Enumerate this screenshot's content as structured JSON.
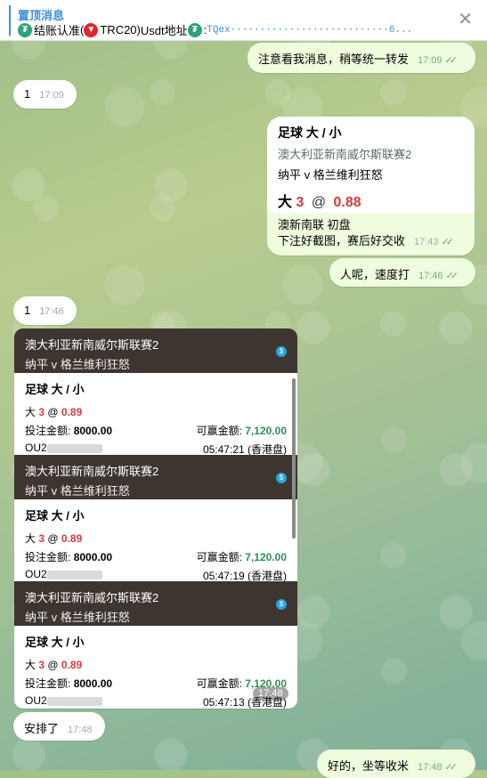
{
  "pinned": {
    "title": "置顶消息",
    "text_prefix": "结账认准",
    "tron_label": "TRC20",
    "text_middle": "Usdt地址",
    "address_label": ": ",
    "address": "TQex···························6..."
  },
  "messages": {
    "m1": {
      "text": "注意看我消息，稍等统一转发",
      "time": "17:09"
    },
    "m2": {
      "text": "1",
      "time": "17:09"
    },
    "card": {
      "line1": "足球 大 / 小",
      "line2": "澳大利亚新南威尔斯联赛2",
      "line3": "纳平 v 格兰维利狂怒",
      "pick": "大",
      "line_val": "3",
      "at": "@",
      "odds": "0.88",
      "note1": "澳新南联 初盘",
      "note2": "下注好截图，赛后好交收",
      "time": "17:43"
    },
    "m4": {
      "text": "人呢，速度打",
      "time": "17:46"
    },
    "m5": {
      "text": "1",
      "time": "17:46"
    },
    "m6": {
      "text": "安排了",
      "time": "17:48"
    },
    "m7": {
      "text": "好的，坐等收米",
      "time": "17:48"
    }
  },
  "bets": [
    {
      "league": "澳大利亚新南威尔斯联赛2",
      "teams": "纳平   v   格兰维利狂怒",
      "market": "足球 大 / 小",
      "pick": "大",
      "line": "3",
      "odds": "0.89",
      "stake_label": "投注金额:",
      "stake": "8000.00",
      "win_label": "可赢金额:",
      "win": "7,120.00",
      "id_prefix": "OU2",
      "time": "05:47:21 (香港盘)"
    },
    {
      "league": "澳大利亚新南威尔斯联赛2",
      "teams": "纳平   v   格兰维利狂怒",
      "market": "足球 大 / 小",
      "pick": "大",
      "line": "3",
      "odds": "0.89",
      "stake_label": "投注金额:",
      "stake": "8000.00",
      "win_label": "可赢金额:",
      "win": "7,120.00",
      "id_prefix": "OU2",
      "time": "05:47:19 (香港盘)"
    },
    {
      "league": "澳大利亚新南威尔斯联赛2",
      "teams": "纳平   v   格兰维利狂怒",
      "market": "足球 大 / 小",
      "pick": "大",
      "line": "3",
      "odds": "0.89",
      "stake_label": "投注金额:",
      "stake": "8000.00",
      "win_label": "可赢金额:",
      "win": "7,120.00",
      "id_prefix": "OU2",
      "time": "05:47:13 (香港盘)"
    }
  ],
  "image_time": "17:48",
  "colors": {
    "accent": "#3a8fd8",
    "outgoing_bubble": "#effdde",
    "bet_header": "#3d3530",
    "odds_red": "#d63a3a",
    "win_green": "#2e8f5a"
  }
}
